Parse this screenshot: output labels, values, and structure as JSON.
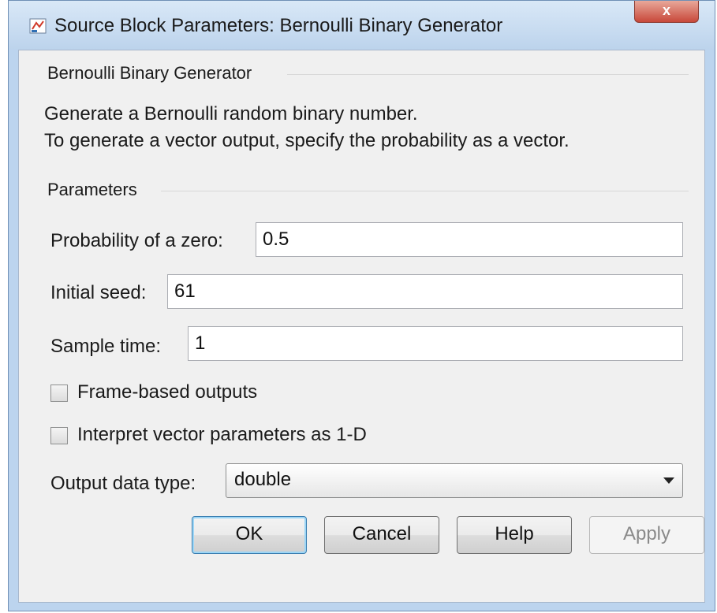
{
  "window": {
    "title": "Source Block Parameters: Bernoulli Binary Generator",
    "close_label": "x"
  },
  "block_group": {
    "title": "Bernoulli Binary Generator",
    "description_line1": "Generate a Bernoulli random binary number.",
    "description_line2": "To generate a vector output, specify the probability as a vector."
  },
  "parameters": {
    "title": "Parameters",
    "probability_label": "Probability of a zero:",
    "probability_value": "0.5",
    "seed_label": "Initial seed:",
    "seed_value": "61",
    "sample_time_label": "Sample time:",
    "sample_time_value": "1",
    "frame_based_label": "Frame-based outputs",
    "frame_based_checked": false,
    "interpret_vector_label": "Interpret vector parameters as 1-D",
    "interpret_vector_checked": false,
    "output_type_label": "Output data type:",
    "output_type_value": "double"
  },
  "buttons": {
    "ok": "OK",
    "cancel": "Cancel",
    "help": "Help",
    "apply": "Apply"
  },
  "icons": {
    "title_icon": "simulink-block-icon",
    "dropdown": "chevron-down-icon"
  },
  "colors": {
    "titlebar": "#bcd4ee",
    "client_bg": "#f0f0f0",
    "close_button": "#c8483a",
    "default_button_glow": "#9cd5f5"
  }
}
